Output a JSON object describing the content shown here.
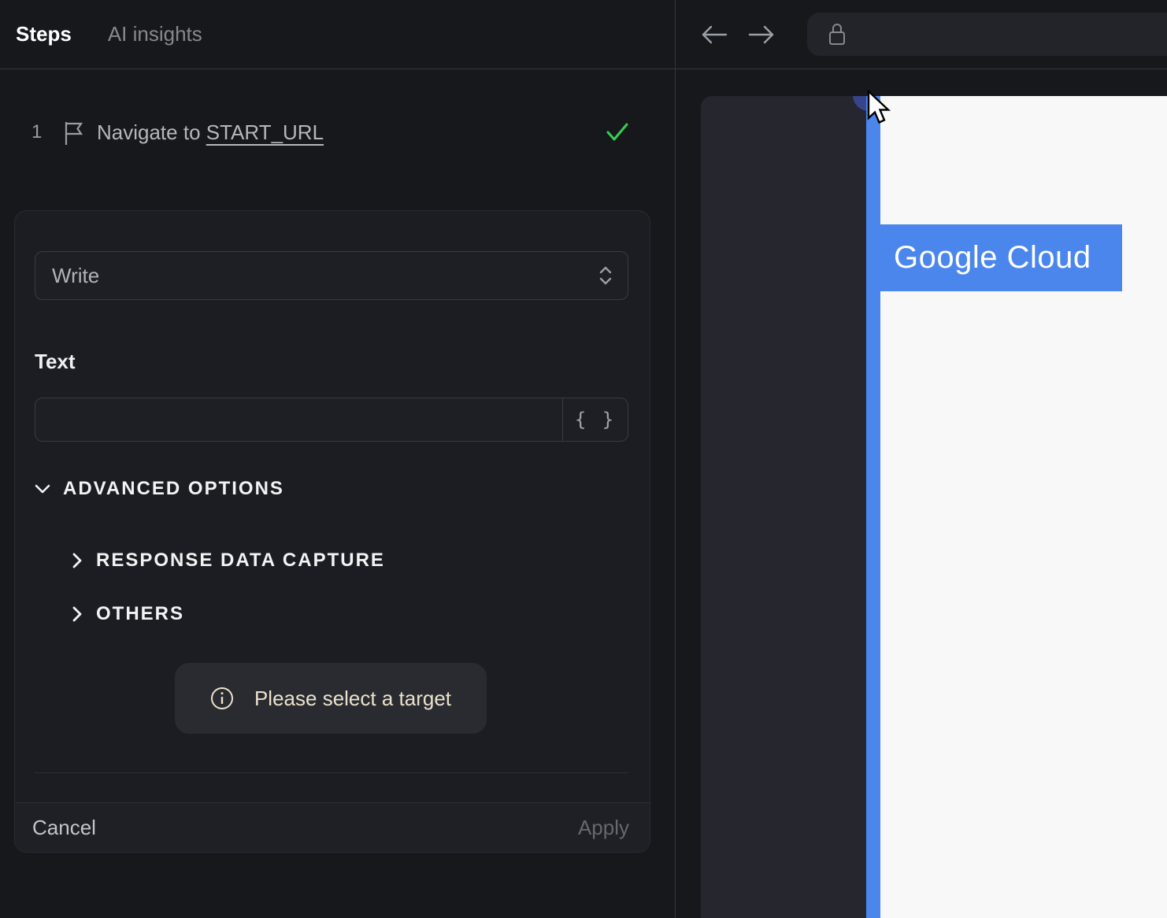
{
  "left_panel": {
    "tabs": [
      {
        "label": "Steps"
      },
      {
        "label": "AI insights"
      }
    ],
    "step": {
      "number": "1",
      "text_prefix": "Navigate to ",
      "link_text": "START_URL"
    },
    "editor": {
      "action_select_value": "Write",
      "text_field_label": "Text",
      "text_input_value": "",
      "variable_button_label": "{ }",
      "advanced_options_label": "ADVANCED OPTIONS",
      "sections": [
        {
          "label": "RESPONSE DATA CAPTURE"
        },
        {
          "label": "OTHERS"
        }
      ],
      "notice_text": "Please select a target",
      "cancel_label": "Cancel",
      "apply_label": "Apply"
    }
  },
  "browser": {
    "url_value": "",
    "page": {
      "highlight_label": "Google Cloud"
    }
  },
  "colors": {
    "accent_blue": "#4b86ec",
    "success_green": "#35d054",
    "notice_cream": "#ebe2cc",
    "selection_navy": "#364489",
    "panel_dark": "#25262e",
    "page_white": "#f8f8f9"
  }
}
